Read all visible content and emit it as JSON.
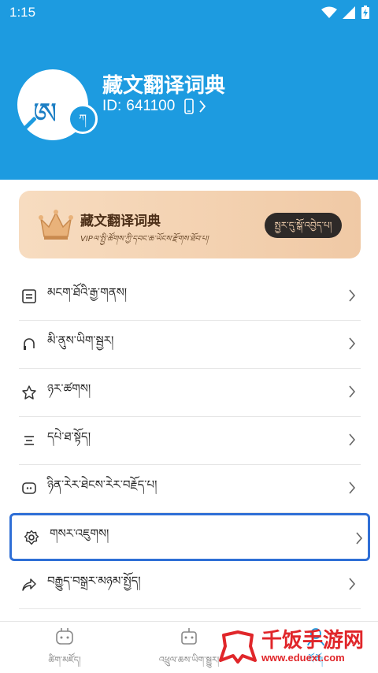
{
  "status_bar": {
    "time": "1:15"
  },
  "profile": {
    "app_title": "藏文翻译词典",
    "id_label": "ID:",
    "id_value": "641100",
    "avatar_glyph": "ཨ",
    "avatar_badge_glyph": "ཀ"
  },
  "vip_card": {
    "title": "藏文翻译词典",
    "subtitle": "VIPལ་སྤྱི་ཚོགས་ཀྱི་དབང་ཆ་ཡོངས་རྫོགས་ཐོབ་པ།",
    "button_label": "སྤྱར་དུ་སྒོ་འབྱེད་པ།"
  },
  "menu": {
    "items": [
      {
        "label": "མངག་ཐོའི་རྒྱ་གནས།",
        "icon": "document-icon"
      },
      {
        "label": "མི་ནུས་ཡིག་སྦྱར།",
        "icon": "headset-icon"
      },
      {
        "label": "ཉར་ཚགས།",
        "icon": "star-icon"
      },
      {
        "label": "དཔེ་ཐ་སྟོད།",
        "icon": "list-icon"
      },
      {
        "label": "ཉིན་རེར་ཐེངས་རེར་བརྗོད་པ།",
        "icon": "chat-icon"
      },
      {
        "label": "གསར་འཇུགས།",
        "icon": "settings-icon"
      },
      {
        "label": "བརྒྱུད་བསྒྲར་མཉམ་སྤྱོད།",
        "icon": "share-icon"
      }
    ]
  },
  "tabbar": {
    "tabs": [
      {
        "label": "ཚིག་མཛོད།"
      },
      {
        "label": "འཕྲུལ་ཆས་ཡིག་སྒྱུར།"
      },
      {
        "label": "ངོ་བོ།"
      }
    ]
  },
  "watermark": {
    "name": "千饭手游网",
    "url": "www.eduext.com"
  },
  "colors": {
    "header": "#1d9be0",
    "highlight_border": "#2f6fd6",
    "watermark": "#e0262a"
  }
}
